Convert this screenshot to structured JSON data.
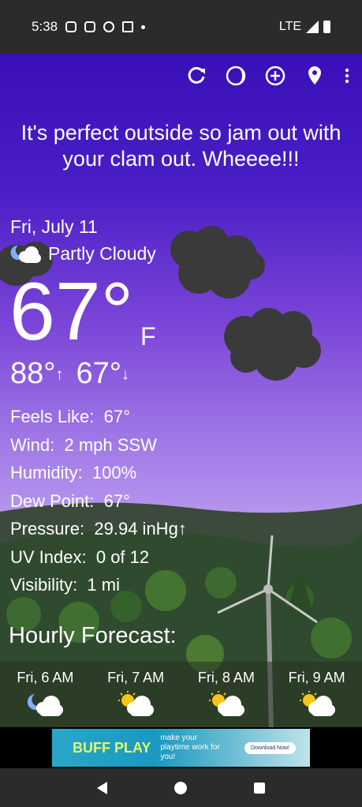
{
  "status": {
    "time": "5:38",
    "network": "LTE",
    "icons": [
      "instagram-icon",
      "instagram-icon",
      "alarm-icon",
      "gmail-icon",
      "dot-icon"
    ]
  },
  "toolbar": {
    "icons": [
      "refresh-icon",
      "moon-phase-icon",
      "add-location-icon",
      "location-pin-icon",
      "more-vert-icon"
    ]
  },
  "tagline": "It's perfect outside so jam out with your clam out. Wheeee!!!",
  "weather": {
    "date": "Fri, July 11",
    "condition": "Partly Cloudy",
    "temperature": "67°",
    "unit": "F",
    "high": "88°",
    "low": "67°"
  },
  "details": [
    {
      "label": "Feels Like:",
      "value": "67°"
    },
    {
      "label": "Wind:",
      "value": "2 mph SSW"
    },
    {
      "label": "Humidity:",
      "value": "100%"
    },
    {
      "label": "Dew Point:",
      "value": "67°"
    },
    {
      "label": "Pressure:",
      "value": "29.94 inHg↑"
    },
    {
      "label": "UV Index:",
      "value": "0 of 12"
    },
    {
      "label": "Visibility:",
      "value": "1 mi"
    }
  ],
  "hourly": {
    "title": "Hourly Forecast:",
    "items": [
      {
        "time": "Fri, 6 AM",
        "icon": "partly-cloudy-night-icon"
      },
      {
        "time": "Fri, 7 AM",
        "icon": "partly-cloudy-day-icon"
      },
      {
        "time": "Fri, 8 AM",
        "icon": "partly-cloudy-day-icon"
      },
      {
        "time": "Fri, 9 AM",
        "icon": "partly-cloudy-day-icon"
      }
    ]
  },
  "ad": {
    "brand": "BUFF PLAY",
    "tagline": "make your playtime work for you!",
    "cta": "Download Now!"
  },
  "colors": {
    "sky_top": "#3a0fb8",
    "sky_bottom": "#b99aee",
    "cloud": "#3a3a3a"
  }
}
